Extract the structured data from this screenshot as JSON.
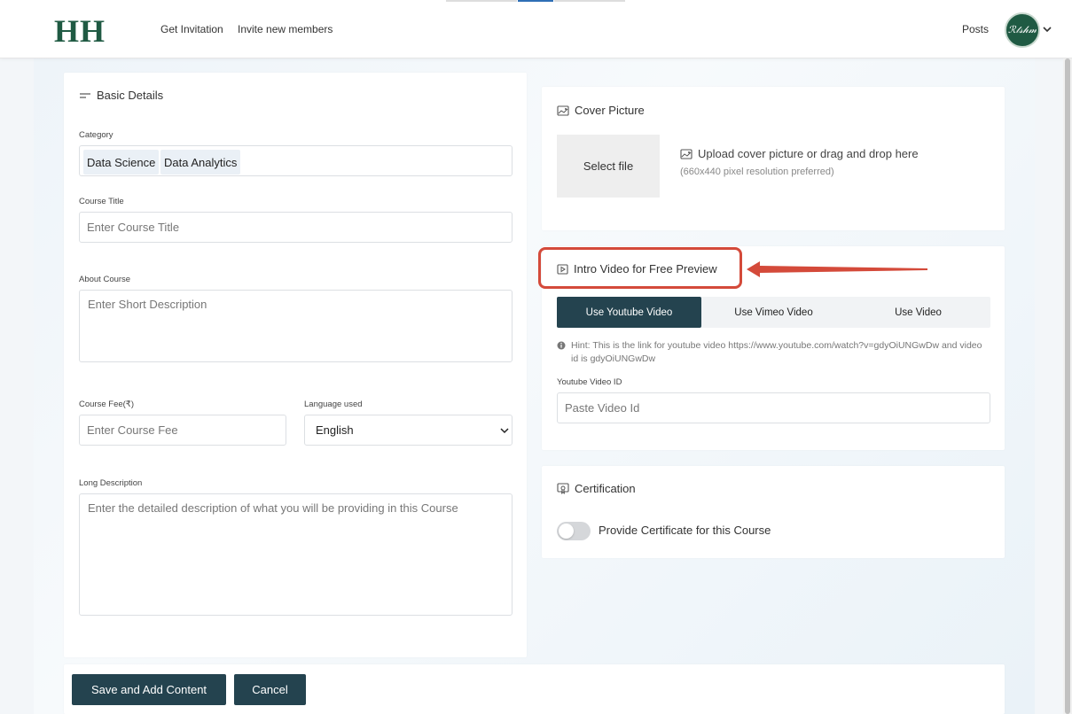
{
  "colors": {
    "brand": "#1f5a43",
    "primary_button": "#24434f",
    "highlight": "#d44a3a",
    "tag_bg": "#eaf0f6"
  },
  "header": {
    "logo": "HH",
    "nav": [
      "Get Invitation",
      "Invite new members"
    ],
    "posts_link": "Posts",
    "avatar_text": "ℛ𝓉𝓈𝒽𝓂"
  },
  "basic_details": {
    "title": "Basic Details",
    "category": {
      "label": "Category",
      "tags": [
        "Data Science",
        "Data Analytics"
      ]
    },
    "course_title": {
      "label": "Course Title",
      "placeholder": "Enter Course Title"
    },
    "about_course": {
      "label": "About Course",
      "placeholder": "Enter Short Description"
    },
    "course_fee": {
      "label": "Course Fee(₹)",
      "placeholder": "Enter Course Fee"
    },
    "language": {
      "label": "Language used",
      "selected": "English"
    },
    "long_description": {
      "label": "Long Description",
      "placeholder": "Enter the detailed description of what you will be providing in this Course"
    }
  },
  "cover_picture": {
    "title": "Cover Picture",
    "select_file": "Select file",
    "upload_text": "Upload cover picture or drag and drop here",
    "resolution_note": "(660x440 pixel resolution preferred)"
  },
  "intro_video": {
    "title": "Intro Video for Free Preview",
    "tabs": [
      "Use Youtube Video",
      "Use Vimeo Video",
      "Use Video"
    ],
    "active_tab": "Use Youtube Video",
    "hint": "Hint: This is the link for youtube video https://www.youtube.com/watch?v=gdyOiUNGwDw and video id is gdyOiUNGwDw",
    "field_label": "Youtube Video ID",
    "placeholder": "Paste Video Id"
  },
  "certification": {
    "title": "Certification",
    "toggle_label": "Provide Certificate for this Course",
    "enabled": false
  },
  "actions": {
    "save": "Save and Add Content",
    "cancel": "Cancel"
  }
}
